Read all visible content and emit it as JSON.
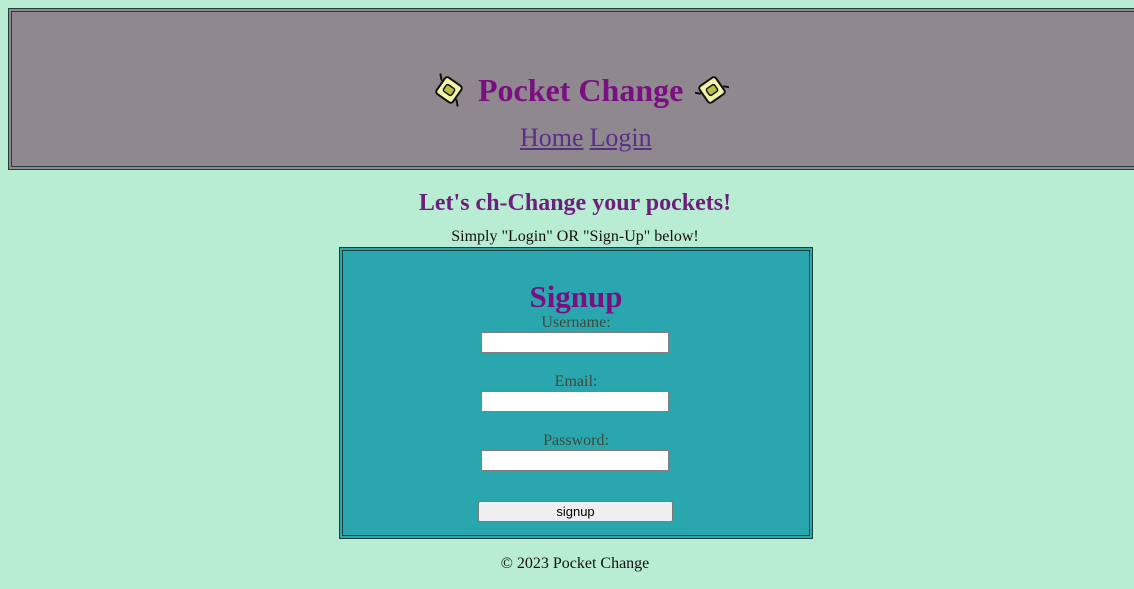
{
  "header": {
    "title": "Pocket Change",
    "logo_icon": "pocket-change-logo-icon",
    "nav": [
      {
        "label": "Home"
      },
      {
        "label": "Login"
      }
    ]
  },
  "hero": {
    "title": "Let's ch-Change your pockets!",
    "subtitle": "Simply \"Login\" OR \"Sign-Up\" below!"
  },
  "signup": {
    "title": "Signup",
    "fields": {
      "username": {
        "label": "Username:",
        "value": ""
      },
      "email": {
        "label": "Email:",
        "value": ""
      },
      "password": {
        "label": "Password:",
        "value": ""
      }
    },
    "button_label": "signup"
  },
  "footer": {
    "text": "© 2023 Pocket Change"
  },
  "colors": {
    "page_background": "#b8ecd3",
    "header_background": "#8f898f",
    "form_background": "#2aa7ae",
    "brand_purple": "#7b0f82"
  }
}
